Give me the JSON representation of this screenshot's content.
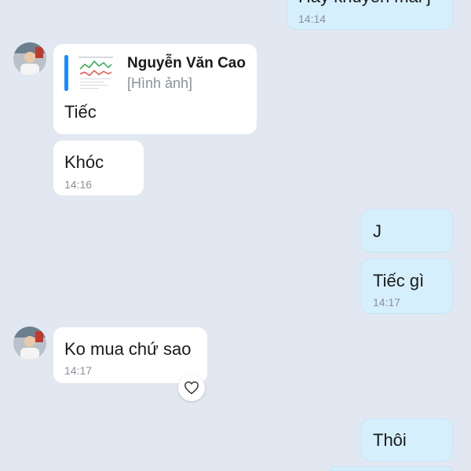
{
  "chat": {
    "messages": [
      {
        "sender": "me",
        "text": "Hay khuyến mãi j",
        "time": "14:14"
      },
      {
        "sender": "other",
        "reply": {
          "name": "Nguyễn Văn Cao",
          "preview": "[Hình ảnh]"
        },
        "text": "Tiếc"
      },
      {
        "sender": "other",
        "text": "Khóc",
        "time": "14:16"
      },
      {
        "sender": "me",
        "text": "J"
      },
      {
        "sender": "me",
        "text": "Tiếc gì",
        "time": "14:17"
      },
      {
        "sender": "other",
        "text": "Ko mua chứ sao",
        "time": "14:17"
      },
      {
        "sender": "me",
        "text": "Thôi"
      }
    ]
  },
  "icons": {
    "react": "heart-outline-icon",
    "avatar": "contact-avatar"
  },
  "colors": {
    "background": "#e2e8f1",
    "incoming_bubble": "#ffffff",
    "outgoing_bubble": "#d6effd",
    "reply_accent": "#1a8cff",
    "timestamp": "#8a9199"
  }
}
